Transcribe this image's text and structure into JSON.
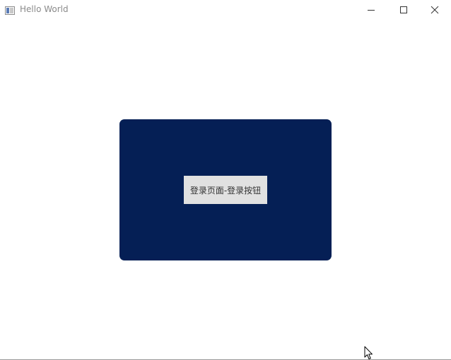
{
  "window": {
    "title": "Hello World",
    "icons": {
      "app": "app-window-icon",
      "minimize": "minimize-icon",
      "maximize": "maximize-icon",
      "close": "close-icon",
      "cursor": "mouse-cursor-icon"
    }
  },
  "card": {
    "background_color": "#051f55",
    "button_label": "登录页面-登录按钮",
    "button_color": "#e1e1e1"
  }
}
